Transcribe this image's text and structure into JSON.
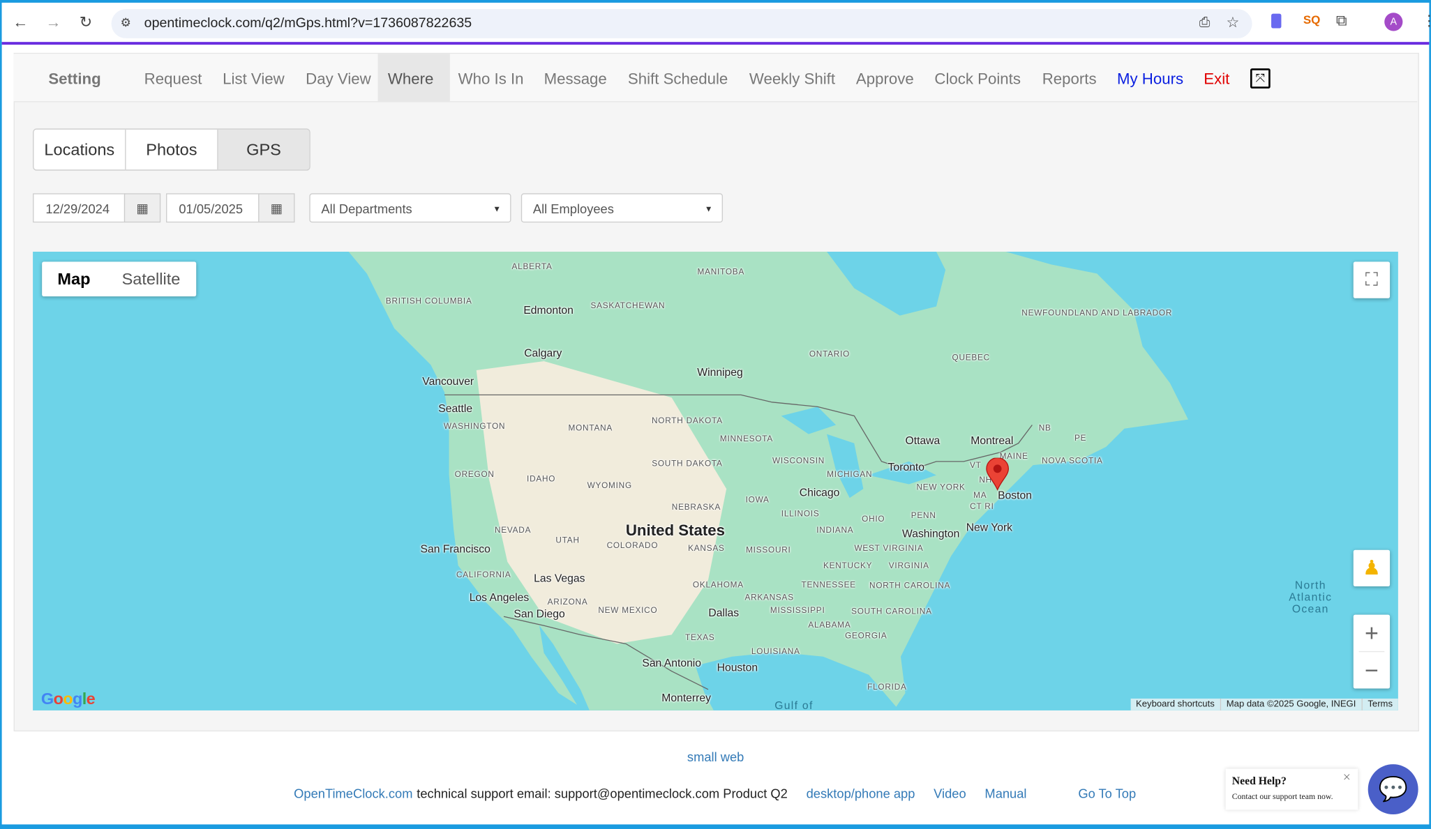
{
  "browser": {
    "url": "opentimeclock.com/q2/mGps.html?v=1736087822635",
    "profile_initial": "A"
  },
  "nav": {
    "items": [
      {
        "label": "Setting",
        "color": "#0a3fe0"
      },
      {
        "label": "Request"
      },
      {
        "label": "List View"
      },
      {
        "label": "Day View"
      },
      {
        "label": "Where",
        "active": true
      },
      {
        "label": "Who Is In"
      },
      {
        "label": "Message"
      },
      {
        "label": "Shift Schedule"
      },
      {
        "label": "Weekly Shift"
      },
      {
        "label": "Approve"
      },
      {
        "label": "Clock Points"
      },
      {
        "label": "Reports"
      },
      {
        "label": "My Hours",
        "color": "#0a1fe0"
      },
      {
        "label": "Exit",
        "color": "#e00000"
      }
    ],
    "fullscreen_icon": "expand-icon"
  },
  "tabs": [
    {
      "label": "Locations"
    },
    {
      "label": "Photos"
    },
    {
      "label": "GPS",
      "active": true
    }
  ],
  "filters": {
    "start_date": "12/29/2024",
    "end_date": "01/05/2025",
    "department": "All Departments",
    "employee": "All Employees"
  },
  "map": {
    "type_buttons": [
      "Map",
      "Satellite"
    ],
    "selected_type": "Map",
    "attribution": [
      "Keyboard shortcuts",
      "Map data ©2025 Google, INEGI",
      "Terms"
    ],
    "logo": "Google",
    "marker": {
      "near": "Boston",
      "color": "#ea4335"
    },
    "labels": [
      {
        "text": "ALBERTA",
        "kind": "state"
      },
      {
        "text": "MANITOBA",
        "kind": "state"
      },
      {
        "text": "BRITISH COLUMBIA",
        "kind": "state"
      },
      {
        "text": "SASKATCHEWAN",
        "kind": "state"
      },
      {
        "text": "Edmonton",
        "kind": "city"
      },
      {
        "text": "NEWFOUNDLAND AND LABRADOR",
        "kind": "state"
      },
      {
        "text": "ONTARIO",
        "kind": "state"
      },
      {
        "text": "QUEBEC",
        "kind": "state"
      },
      {
        "text": "Calgary",
        "kind": "city"
      },
      {
        "text": "Winnipeg",
        "kind": "city"
      },
      {
        "text": "Vancouver",
        "kind": "city"
      },
      {
        "text": "Seattle",
        "kind": "city"
      },
      {
        "text": "WASHINGTON",
        "kind": "state"
      },
      {
        "text": "MONTANA",
        "kind": "state"
      },
      {
        "text": "NORTH DAKOTA",
        "kind": "state"
      },
      {
        "text": "MINNESOTA",
        "kind": "state"
      },
      {
        "text": "NB",
        "kind": "state"
      },
      {
        "text": "PE",
        "kind": "state"
      },
      {
        "text": "Ottawa",
        "kind": "city"
      },
      {
        "text": "Montreal",
        "kind": "city"
      },
      {
        "text": "MAINE",
        "kind": "state"
      },
      {
        "text": "NOVA SCOTIA",
        "kind": "state"
      },
      {
        "text": "OREGON",
        "kind": "state"
      },
      {
        "text": "IDAHO",
        "kind": "state"
      },
      {
        "text": "SOUTH DAKOTA",
        "kind": "state"
      },
      {
        "text": "WISCONSIN",
        "kind": "state"
      },
      {
        "text": "MICHIGAN",
        "kind": "state"
      },
      {
        "text": "Toronto",
        "kind": "city"
      },
      {
        "text": "VT",
        "kind": "state"
      },
      {
        "text": "WYOMING",
        "kind": "state"
      },
      {
        "text": "NEW YORK",
        "kind": "state"
      },
      {
        "text": "NH",
        "kind": "state"
      },
      {
        "text": "MA",
        "kind": "state"
      },
      {
        "text": "Boston",
        "kind": "city"
      },
      {
        "text": "CT RI",
        "kind": "state"
      },
      {
        "text": "IOWA",
        "kind": "state"
      },
      {
        "text": "Chicago",
        "kind": "city"
      },
      {
        "text": "NEBRASKA",
        "kind": "state"
      },
      {
        "text": "ILLINOIS",
        "kind": "state"
      },
      {
        "text": "OHIO",
        "kind": "state"
      },
      {
        "text": "PENN",
        "kind": "state"
      },
      {
        "text": "INDIANA",
        "kind": "state"
      },
      {
        "text": "United States",
        "kind": "country"
      },
      {
        "text": "NEVADA",
        "kind": "state"
      },
      {
        "text": "UTAH",
        "kind": "state"
      },
      {
        "text": "COLORADO",
        "kind": "state"
      },
      {
        "text": "KANSAS",
        "kind": "state"
      },
      {
        "text": "MISSOURI",
        "kind": "state"
      },
      {
        "text": "Washington",
        "kind": "city"
      },
      {
        "text": "New York",
        "kind": "city"
      },
      {
        "text": "San Francisco",
        "kind": "city"
      },
      {
        "text": "WEST VIRGINIA",
        "kind": "state"
      },
      {
        "text": "KENTUCKY",
        "kind": "state"
      },
      {
        "text": "VIRGINIA",
        "kind": "state"
      },
      {
        "text": "CALIFORNIA",
        "kind": "state"
      },
      {
        "text": "Las Vegas",
        "kind": "city"
      },
      {
        "text": "OKLAHOMA",
        "kind": "state"
      },
      {
        "text": "TENNESSEE",
        "kind": "state"
      },
      {
        "text": "NORTH CAROLINA",
        "kind": "state"
      },
      {
        "text": "ARIZONA",
        "kind": "state"
      },
      {
        "text": "Los Angeles",
        "kind": "city"
      },
      {
        "text": "ARKANSAS",
        "kind": "state"
      },
      {
        "text": "SOUTH CAROLINA",
        "kind": "state"
      },
      {
        "text": "MISSISSIPPI",
        "kind": "state"
      },
      {
        "text": "NEW MEXICO",
        "kind": "state"
      },
      {
        "text": "San Diego",
        "kind": "city"
      },
      {
        "text": "Dallas",
        "kind": "city"
      },
      {
        "text": "ALABAMA",
        "kind": "state"
      },
      {
        "text": "GEORGIA",
        "kind": "state"
      },
      {
        "text": "TEXAS",
        "kind": "state"
      },
      {
        "text": "LOUISIANA",
        "kind": "state"
      },
      {
        "text": "San Antonio",
        "kind": "city"
      },
      {
        "text": "Houston",
        "kind": "city"
      },
      {
        "text": "FLORIDA",
        "kind": "state"
      },
      {
        "text": "Monterrey",
        "kind": "city"
      },
      {
        "text": "Gulf of",
        "kind": "ocean"
      },
      {
        "text": "North Atlantic Ocean",
        "kind": "ocean"
      }
    ]
  },
  "footer": {
    "small_web": "small web",
    "site": "OpenTimeClock.com",
    "support_text": "technical support email: support@opentimeclock.com Product Q2",
    "links": [
      "desktop/phone app",
      "Video",
      "Manual",
      "Go To Top"
    ]
  },
  "help": {
    "title": "Need Help?",
    "subtitle": "Contact our support team now.",
    "close": "×"
  }
}
